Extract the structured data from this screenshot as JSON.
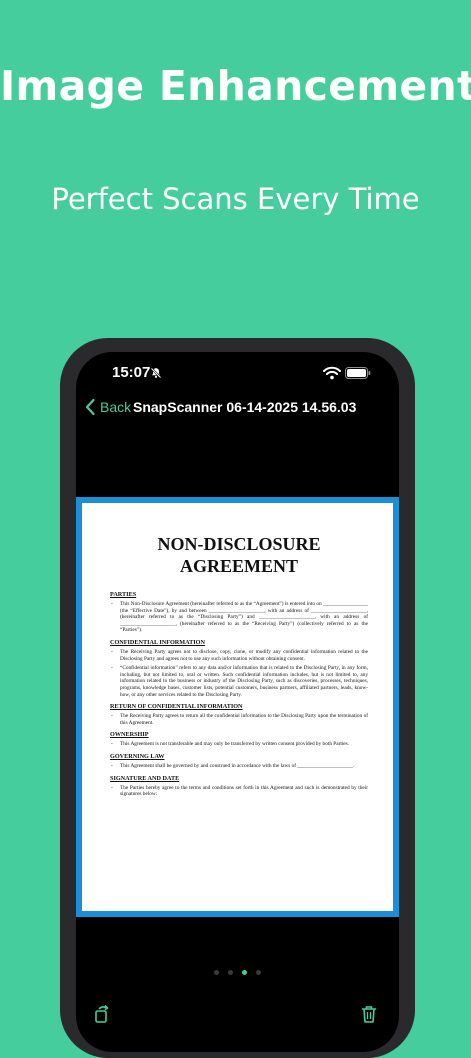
{
  "promo": {
    "headline": "Image Enhancement",
    "subheadline": "Perfect Scans Every Time"
  },
  "status_bar": {
    "time": "15:07"
  },
  "nav": {
    "back_label": "Back",
    "title": "SnapScanner 06-14-2025 14.56.03"
  },
  "document": {
    "title_line1": "NON-DISCLOSURE",
    "title_line2": "AGREEMENT",
    "sections": [
      {
        "heading": "PARTIES",
        "paragraphs": [
          "This Non-Disclosure Agreement (hereinafter referred to as the “Agreement”) is entered into on _________________ (the “Effective Date”), by and between _____________________, with an address of _____________________, (hereinafter referred to as the “Disclosing Party”) and _____________________, with an address of _____________________, (hereinafter referred to as the “Receiving Party”) (collectively referred to as the “Parties”)."
        ]
      },
      {
        "heading": "CONFIDENTIAL INFORMATION",
        "paragraphs": [
          "The Receiving Party agrees not to disclose, copy, clone, or modify any confidential information related to the Disclosing Party and agrees not to use any such information without obtaining consent.",
          "“Confidential information” refers to any data and/or information that is related to the Disclosing Party, in any form, including, but not limited to, oral or written. Such confidential information includes, but is not limited to, any information related to the business or industry of the Disclosing Party, such as discoveries, processes, techniques, programs, knowledge bases, customer lists, potential customers, business partners, affiliated partners, leads, know-how, or any other services related to the Disclosing Party."
        ]
      },
      {
        "heading": "RETURN OF CONFIDENTIAL INFORMATION",
        "paragraphs": [
          "The Receiving Party agrees to return all the confidential information to the Disclosing Party upon the termination of this Agreement."
        ]
      },
      {
        "heading": "OWNERSHIP",
        "paragraphs": [
          "This Agreement is not transferable and may only be transferred by written consent provided by both Parties."
        ]
      },
      {
        "heading": "GOVERNING LAW",
        "paragraphs": [
          "This Agreement shall be governed by and construed in accordance with the laws of _____________________."
        ]
      },
      {
        "heading": "SIGNATURE AND DATE",
        "paragraphs": [
          "The Parties hereby agree to the terms and conditions set forth in this Agreement and such is demonstrated by their signatures below:"
        ]
      }
    ]
  },
  "pager": {
    "count": 4,
    "active_index": 2
  },
  "icons": {
    "muted": "bell-slash-icon",
    "wifi": "wifi-icon",
    "battery": "battery-icon",
    "back": "chevron-left-icon",
    "rotate": "rotate-icon",
    "delete": "trash-icon"
  },
  "colors": {
    "background": "#45cd9e",
    "accent": "#45cd9e",
    "document_border": "#1a8fd8"
  }
}
